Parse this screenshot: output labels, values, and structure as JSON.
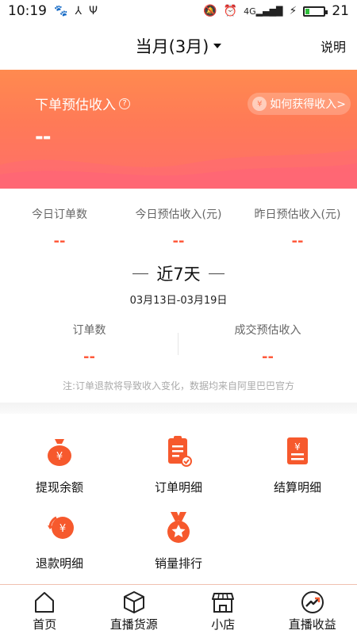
{
  "status_bar": {
    "time": "10:19",
    "battery_level": "21",
    "network": "4G"
  },
  "header": {
    "month_selector": "当月(3月)",
    "explain": "说明"
  },
  "banner": {
    "title": "下单预估收入",
    "value": "--",
    "how_to_earn": "如何获得收入>"
  },
  "today_stats": [
    {
      "label": "今日订单数",
      "value": "--"
    },
    {
      "label": "今日预估收入(元)",
      "value": "--"
    },
    {
      "label": "昨日预估收入(元)",
      "value": "--"
    }
  ],
  "period": {
    "title": "近7天",
    "range": "03月13日-03月19日"
  },
  "period_stats": [
    {
      "label": "订单数",
      "value": "--"
    },
    {
      "label": "成交预估收入",
      "value": "--"
    }
  ],
  "note": "注:订单退款将导致收入变化，数据均来自阿里巴巴官方",
  "grid_items": [
    {
      "label": "提现余额",
      "icon": "money-bag-icon"
    },
    {
      "label": "订单明细",
      "icon": "order-clipboard-icon"
    },
    {
      "label": "结算明细",
      "icon": "settlement-receipt-icon"
    },
    {
      "label": "退款明细",
      "icon": "refund-coin-icon"
    },
    {
      "label": "销量排行",
      "icon": "ranking-medal-icon"
    }
  ],
  "bottom_nav": [
    {
      "label": "首页",
      "icon": "home-icon"
    },
    {
      "label": "直播货源",
      "icon": "cube-icon"
    },
    {
      "label": "小店",
      "icon": "shop-icon"
    },
    {
      "label": "直播收益",
      "icon": "earnings-chart-icon"
    }
  ],
  "colors": {
    "accent": "#ff5a3c",
    "banner_top": "#ff8a4f",
    "banner_bottom": "#ff6f6a",
    "icon_orange": "#f6592d"
  }
}
